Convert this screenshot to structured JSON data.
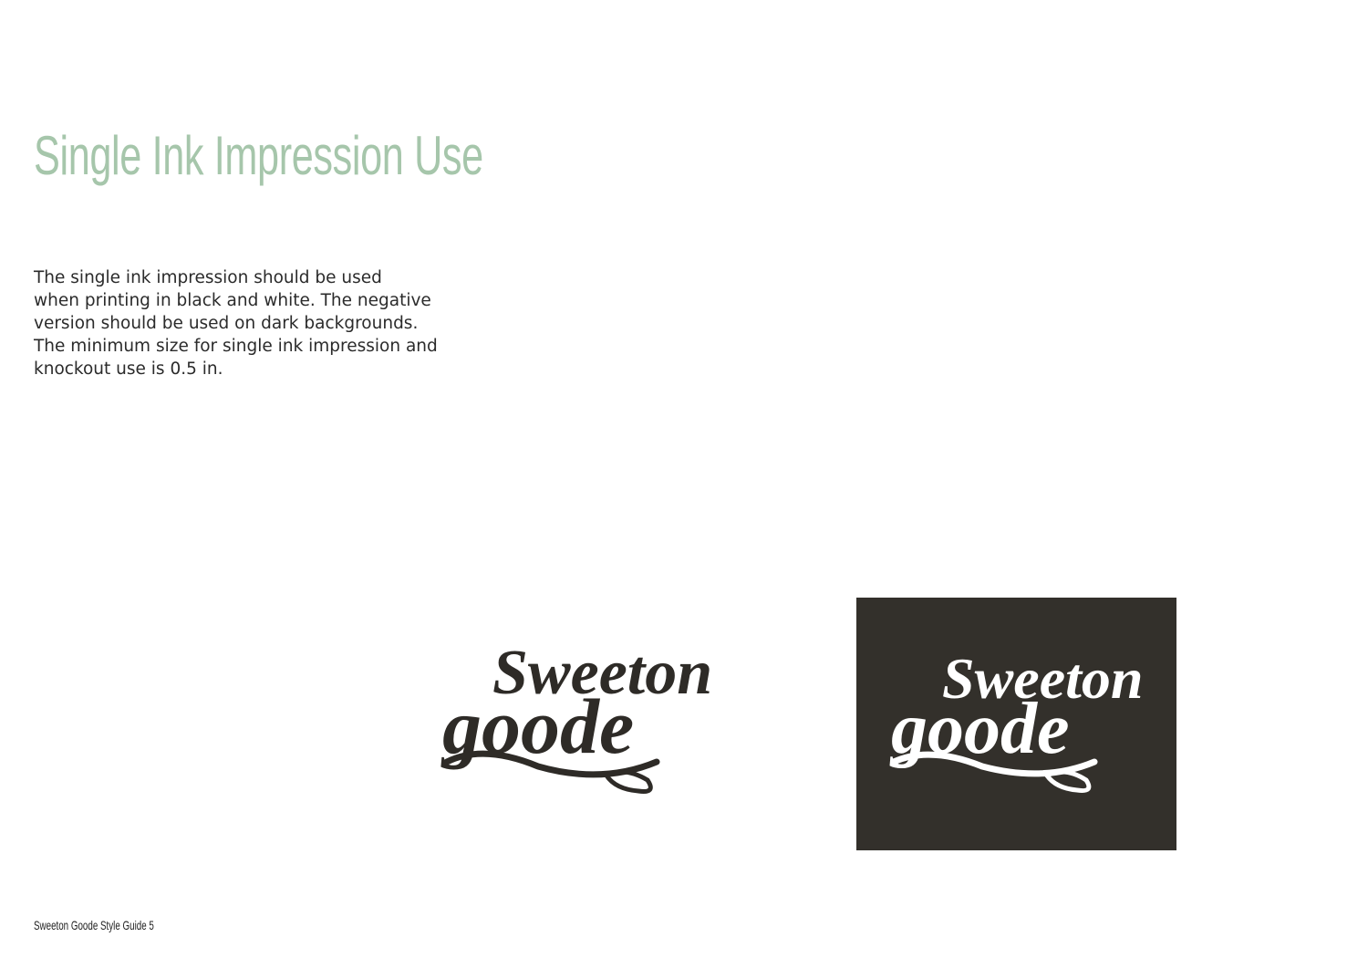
{
  "page": {
    "title": "Single Ink Impression Use",
    "body_lines": [
      "The single ink impression should be used",
      "when printing in black and white. The negative",
      "version should be used on dark backgrounds.",
      "The minimum size for single ink impression and",
      "knockout use is 0.5 in."
    ],
    "footer": "Sweeton Goode Style Guide 5"
  },
  "logo": {
    "line1": "Sweeton",
    "line2": "goode",
    "ink_color": "#2e2b27",
    "negative_background": "#33302b",
    "negative_ink_color": "#ffffff"
  },
  "colors": {
    "title": "#a6c6ab",
    "text": "#2b2b2b"
  }
}
